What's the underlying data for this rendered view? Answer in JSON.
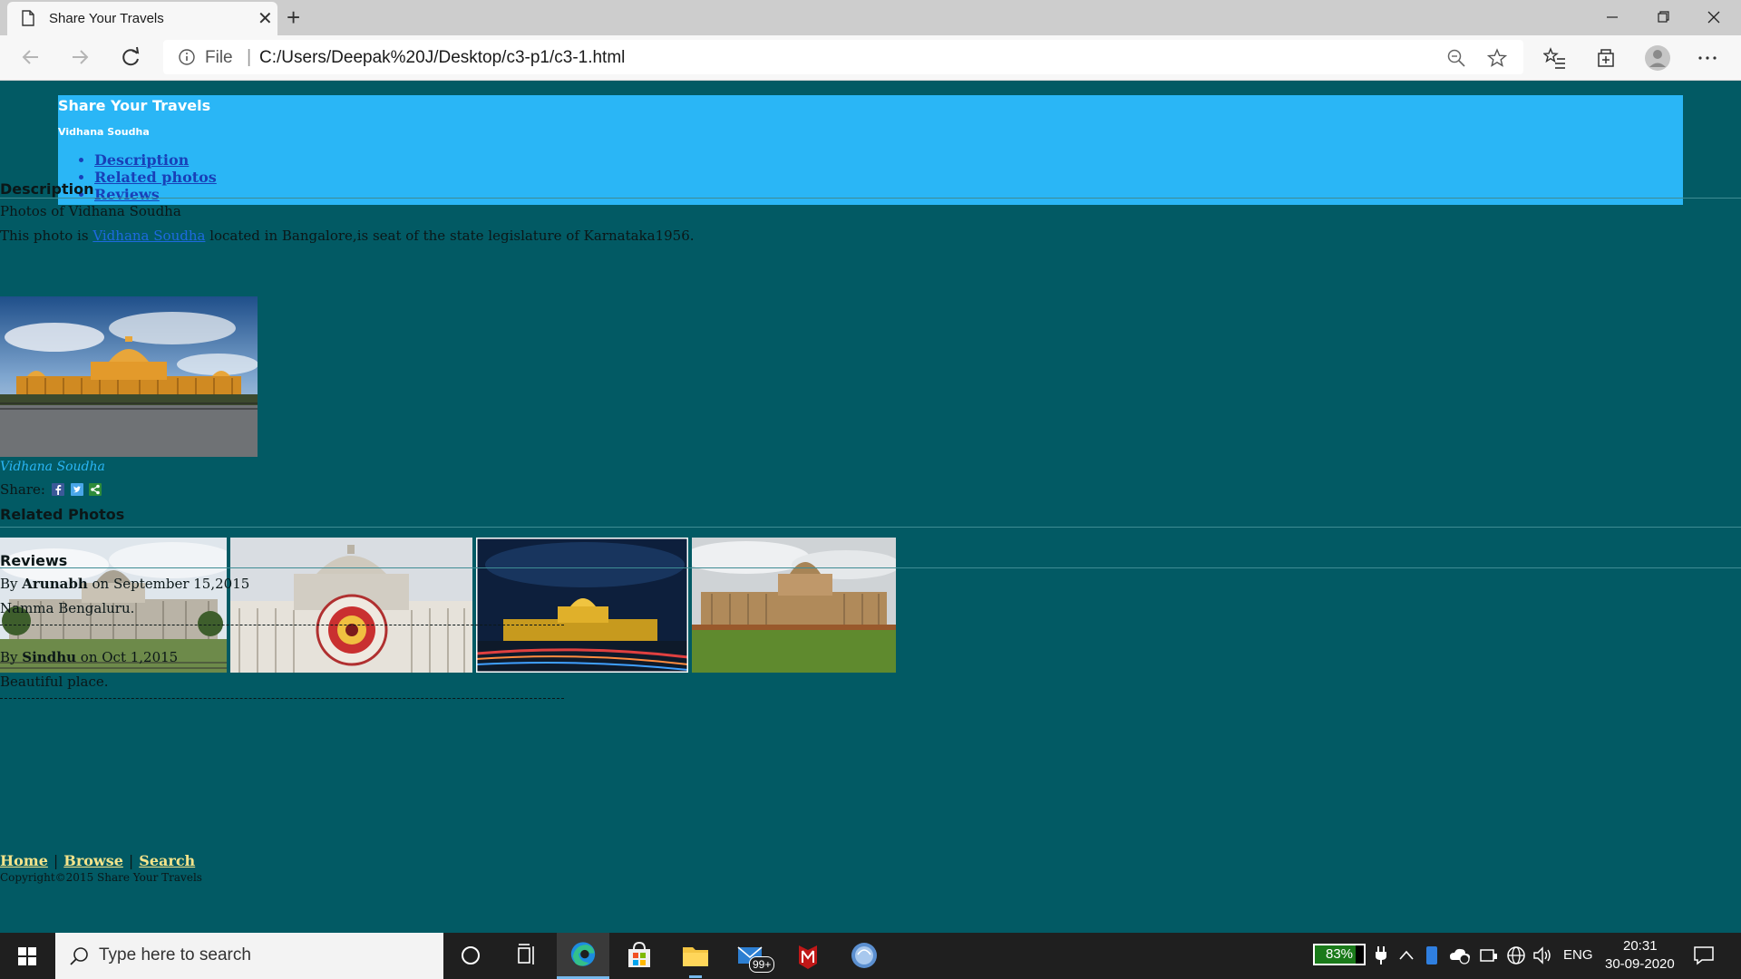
{
  "browser": {
    "tab_title": "Share Your Travels",
    "address_prefix": "File",
    "address_sep": "|",
    "url": "C:/Users/Deepak%20J/Desktop/c3-p1/c3-1.html"
  },
  "page": {
    "header": {
      "title": "Share Your Travels",
      "subtitle": "Vidhana Soudha",
      "nav": [
        "Description",
        "Related photos",
        "Reviews"
      ]
    },
    "description": {
      "heading": "Description",
      "line1": "Photos of Vidhana Soudha",
      "line2_prefix": "This photo is ",
      "line2_link": "Vidhana Soudha",
      "line2_suffix": " located in Bangalore,is seat of the state legislature of Karnataka1956.",
      "caption": "Vidhana Soudha",
      "share_label": "Share:"
    },
    "related": {
      "heading": "Related Photos"
    },
    "reviews": {
      "heading": "Reviews",
      "items": [
        {
          "by": "By ",
          "author": "Arunabh",
          "date": " on September 15,2015",
          "text": "Namma Bengaluru."
        },
        {
          "by": "By ",
          "author": "Sindhu",
          "date": " on Oct 1,2015",
          "text": "Beautiful place."
        }
      ]
    },
    "footer": {
      "links": [
        "Home",
        "Browse",
        "Search"
      ],
      "sep": "|",
      "copyright": "Copyright©2015 Share Your Travels"
    }
  },
  "taskbar": {
    "search_placeholder": "Type here to search",
    "mail_badge": "99+",
    "battery_percent": "83%",
    "battery_level": 0.83,
    "language": "ENG",
    "time": "20:31",
    "date": "30-09-2020"
  },
  "colors": {
    "page_bg": "#025a64",
    "header_bg": "#2ab6f6",
    "link": "#1840b8",
    "footer_link": "#f5e48a"
  }
}
